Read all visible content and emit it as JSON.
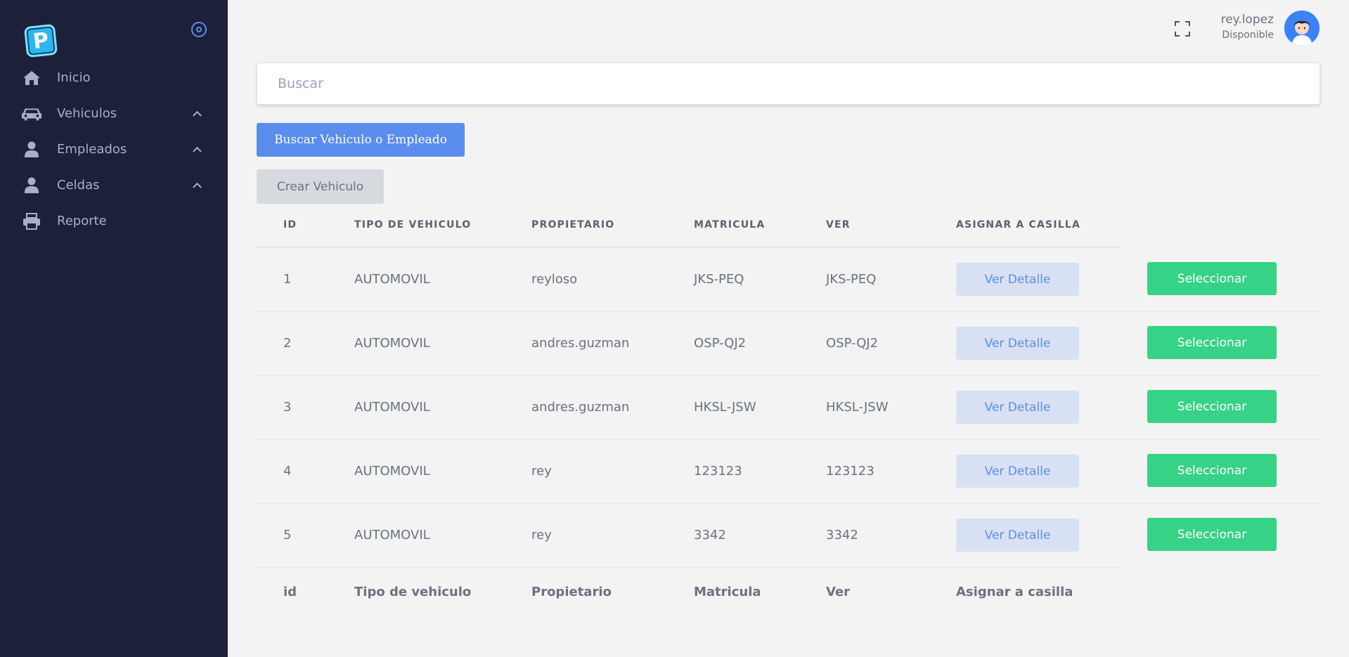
{
  "brand": {
    "logo_letter": "P"
  },
  "sidebar": {
    "items": [
      {
        "label": "Inicio",
        "icon": "home-icon",
        "expandable": false
      },
      {
        "label": "Vehiculos",
        "icon": "car-icon",
        "expandable": true
      },
      {
        "label": "Empleados",
        "icon": "user-icon",
        "expandable": true
      },
      {
        "label": "Celdas",
        "icon": "user-icon",
        "expandable": true
      },
      {
        "label": "Reporte",
        "icon": "printer-icon",
        "expandable": false
      }
    ]
  },
  "header": {
    "user_name": "rey.lopez",
    "user_status": "Disponible"
  },
  "search": {
    "placeholder": "Buscar",
    "value": ""
  },
  "actions": {
    "search_button": "Buscar Vehiculo o Empleado",
    "create_button": "Crear Vehiculo"
  },
  "table": {
    "headers": [
      "ID",
      "TIPO DE VEHICULO",
      "PROPIETARIO",
      "MATRICULA",
      "VER",
      "ASIGNAR A CASILLA"
    ],
    "footers": [
      "id",
      "Tipo de vehiculo",
      "Propietario",
      "Matricula",
      "Ver",
      "Asignar a casilla"
    ],
    "detail_label": "Ver Detalle",
    "select_label": "Seleccionar",
    "rows": [
      {
        "id": "1",
        "tipo": "AUTOMOVIL",
        "propietario": "reyloso",
        "matricula": "JKS-PEQ",
        "ver": "JKS-PEQ"
      },
      {
        "id": "2",
        "tipo": "AUTOMOVIL",
        "propietario": "andres.guzman",
        "matricula": "OSP-QJ2",
        "ver": "OSP-QJ2"
      },
      {
        "id": "3",
        "tipo": "AUTOMOVIL",
        "propietario": "andres.guzman",
        "matricula": "HKSL-JSW",
        "ver": "HKSL-JSW"
      },
      {
        "id": "4",
        "tipo": "AUTOMOVIL",
        "propietario": "rey",
        "matricula": "123123",
        "ver": "123123"
      },
      {
        "id": "5",
        "tipo": "AUTOMOVIL",
        "propietario": "rey",
        "matricula": "3342",
        "ver": "3342"
      }
    ]
  },
  "colors": {
    "sidebar_bg": "#1c2038",
    "accent_blue": "#5b8def",
    "select_green": "#36d285",
    "detail_bg": "#d8e1f3",
    "page_bg": "#f2f3f2"
  }
}
